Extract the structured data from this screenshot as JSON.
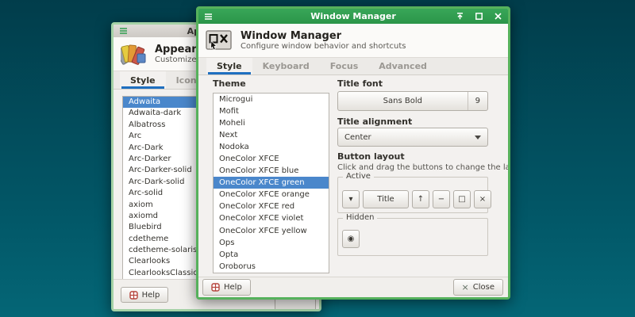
{
  "colors": {
    "desktop_top": "#013d4b",
    "desktop_bottom": "#046676",
    "active_titlebar_green": "#2f9e4f",
    "window_border_green": "#56b15c",
    "inactive_border_green": "#a5d2a6",
    "selection_blue": "#4a87cb",
    "tab_underline_blue": "#1f6fc0"
  },
  "appearance": {
    "titlebar": {
      "title": "Appearance",
      "menu_icon": "hamburger-menu-icon"
    },
    "header": {
      "title": "Appearance",
      "subtitle": "Customize the look of your desktop",
      "icon": "appearance-swatches-icon"
    },
    "tabs": [
      "Style",
      "Icons"
    ],
    "active_tab": "Style",
    "theme_list": {
      "items": [
        "Adwaita",
        "Adwaita-dark",
        "Albatross",
        "Arc",
        "Arc-Dark",
        "Arc-Darker",
        "Arc-Darker-solid",
        "Arc-Dark-solid",
        "Arc-solid",
        "axiom",
        "axiomd",
        "Bluebird",
        "cdetheme",
        "cdetheme-solaris",
        "Clearlooks",
        "ClearlooksClassic"
      ],
      "selected_index": 0
    },
    "footer": {
      "help_label": "Help",
      "help_icon": "help-icon"
    }
  },
  "wm": {
    "titlebar": {
      "title": "Window Manager",
      "menu_icon": "hamburger-menu-icon",
      "controls": [
        "shade-icon",
        "maximize-icon",
        "close-icon"
      ]
    },
    "header": {
      "title": "Window Manager",
      "subtitle": "Configure window behavior and shortcuts",
      "icon": "window-manager-icon"
    },
    "tabs": [
      "Style",
      "Keyboard",
      "Focus",
      "Advanced"
    ],
    "active_tab": "Style",
    "theme": {
      "label": "Theme",
      "items": [
        "Microgui",
        "Mofit",
        "Moheli",
        "Next",
        "Nodoka",
        "OneColor XFCE",
        "OneColor XFCE blue",
        "OneColor XFCE green",
        "OneColor XFCE orange",
        "OneColor XFCE red",
        "OneColor XFCE violet",
        "OneColor XFCE yellow",
        "Ops",
        "Opta",
        "Oroborus"
      ],
      "selected_index": 7
    },
    "title_font": {
      "label": "Title font",
      "font_name": "Sans Bold",
      "font_size": "9"
    },
    "title_alignment": {
      "label": "Title alignment",
      "value": "Center"
    },
    "button_layout": {
      "label": "Button layout",
      "hint": "Click and drag the buttons to change the layout",
      "active": {
        "label": "Active",
        "buttons": [
          "▾",
          "Title",
          "↑",
          "−",
          "□",
          "×"
        ]
      },
      "hidden": {
        "label": "Hidden",
        "buttons": [
          "◉"
        ]
      }
    },
    "footer": {
      "help_label": "Help",
      "help_icon": "help-icon",
      "close_label": "Close",
      "close_icon": "×"
    }
  }
}
